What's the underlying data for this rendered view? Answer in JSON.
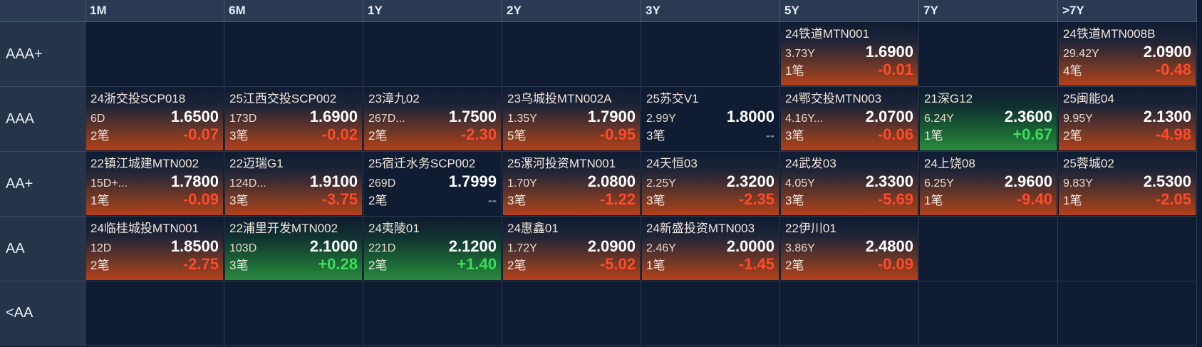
{
  "columns": [
    "1M",
    "6M",
    "1Y",
    "2Y",
    "3Y",
    "5Y",
    "7Y",
    ">7Y"
  ],
  "rows": [
    "AAA+",
    "AAA",
    "AA+",
    "AA",
    "<AA"
  ],
  "cells": {
    "AAA+": [
      null,
      null,
      null,
      null,
      null,
      {
        "name": "24铁道MTN001",
        "term": "3.73Y",
        "price": "1.6900",
        "count": "1笔",
        "change": "-0.01",
        "trend": "down"
      },
      null,
      {
        "name": "24铁道MTN008B",
        "term": "29.42Y",
        "price": "2.0900",
        "count": "4笔",
        "change": "-0.48",
        "trend": "down"
      }
    ],
    "AAA": [
      {
        "name": "24浙交投SCP018",
        "term": "6D",
        "price": "1.6500",
        "count": "2笔",
        "change": "-0.07",
        "trend": "down"
      },
      {
        "name": "25江西交投SCP002",
        "term": "173D",
        "price": "1.6900",
        "count": "3笔",
        "change": "-0.02",
        "trend": "down"
      },
      {
        "name": "23漳九02",
        "term": "267D...",
        "price": "1.7500",
        "count": "2笔",
        "change": "-2.30",
        "trend": "down"
      },
      {
        "name": "23乌城投MTN002A",
        "term": "1.35Y",
        "price": "1.7900",
        "count": "5笔",
        "change": "-0.95",
        "trend": "down"
      },
      {
        "name": "25苏交V1",
        "term": "2.99Y",
        "price": "1.8000",
        "count": "3笔",
        "change": "--",
        "trend": "flat"
      },
      {
        "name": "24鄂交投MTN003",
        "term": "4.16Y...",
        "price": "2.0700",
        "count": "3笔",
        "change": "-0.06",
        "trend": "down"
      },
      {
        "name": "21深G12",
        "term": "6.24Y",
        "price": "2.3600",
        "count": "1笔",
        "change": "+0.67",
        "trend": "up"
      },
      {
        "name": "25闽能04",
        "term": "9.95Y",
        "price": "2.1300",
        "count": "2笔",
        "change": "-4.98",
        "trend": "down"
      }
    ],
    "AA+": [
      {
        "name": "22镇江城建MTN002",
        "term": "15D+...",
        "price": "1.7800",
        "count": "1笔",
        "change": "-0.09",
        "trend": "down"
      },
      {
        "name": "22迈瑞G1",
        "term": "124D...",
        "price": "1.9100",
        "count": "3笔",
        "change": "-3.75",
        "trend": "down"
      },
      {
        "name": "25宿迁水务SCP002",
        "term": "269D",
        "price": "1.7999",
        "count": "2笔",
        "change": "--",
        "trend": "flat"
      },
      {
        "name": "25漯河投资MTN001",
        "term": "1.70Y",
        "price": "2.0800",
        "count": "3笔",
        "change": "-1.22",
        "trend": "down"
      },
      {
        "name": "24天恒03",
        "term": "2.25Y",
        "price": "2.3200",
        "count": "3笔",
        "change": "-2.35",
        "trend": "down"
      },
      {
        "name": "24武发03",
        "term": "4.05Y",
        "price": "2.3300",
        "count": "3笔",
        "change": "-5.69",
        "trend": "down"
      },
      {
        "name": "24上饶08",
        "term": "6.25Y",
        "price": "2.9600",
        "count": "1笔",
        "change": "-9.40",
        "trend": "down"
      },
      {
        "name": "25蓉城02",
        "term": "9.83Y",
        "price": "2.5300",
        "count": "1笔",
        "change": "-2.05",
        "trend": "down"
      }
    ],
    "AA": [
      {
        "name": "24临桂城投MTN001",
        "term": "12D",
        "price": "1.8500",
        "count": "2笔",
        "change": "-2.75",
        "trend": "down"
      },
      {
        "name": "22浦里开发MTN002",
        "term": "103D",
        "price": "2.1000",
        "count": "3笔",
        "change": "+0.28",
        "trend": "up"
      },
      {
        "name": "24夷陵01",
        "term": "221D",
        "price": "2.1200",
        "count": "2笔",
        "change": "+1.40",
        "trend": "up"
      },
      {
        "name": "24惠鑫01",
        "term": "1.72Y",
        "price": "2.0900",
        "count": "2笔",
        "change": "-5.02",
        "trend": "down"
      },
      {
        "name": "24新盛投资MTN003",
        "term": "2.46Y",
        "price": "2.0000",
        "count": "1笔",
        "change": "-1.45",
        "trend": "down"
      },
      {
        "name": "22伊川01",
        "term": "3.86Y",
        "price": "2.4800",
        "count": "2笔",
        "change": "-0.09",
        "trend": "down"
      },
      null,
      null
    ],
    "<AA": [
      null,
      null,
      null,
      null,
      null,
      null,
      null,
      null
    ]
  },
  "colors": {
    "down": "#ff4a2a",
    "up": "#3ddc5a",
    "background": "#0f1c31",
    "header": "#2a3a52"
  }
}
